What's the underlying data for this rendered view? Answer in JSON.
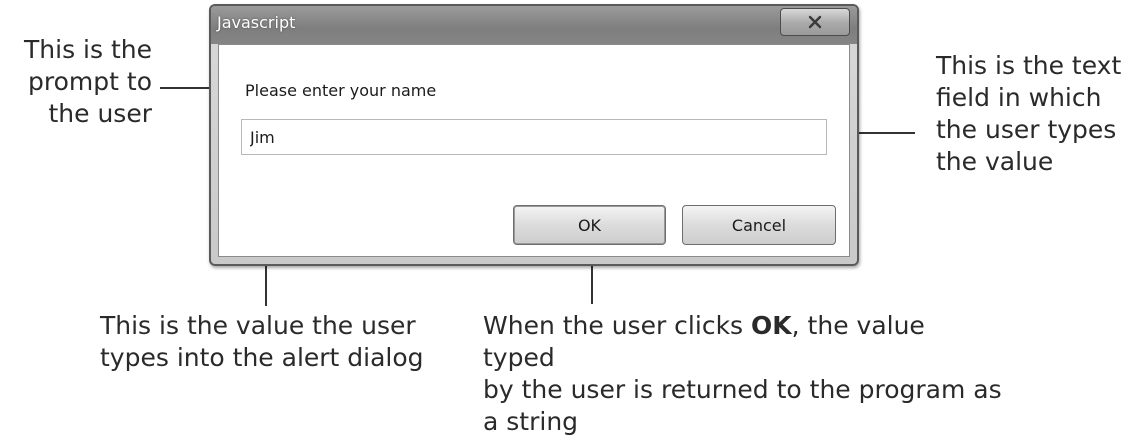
{
  "dialog": {
    "title": "Javascript",
    "close_label": "X",
    "prompt": "Please enter your name",
    "input_value": "Jim",
    "ok_label": "OK",
    "cancel_label": "Cancel"
  },
  "annotations": {
    "prompt": "This is the\nprompt to\nthe user",
    "text_field": "This is the text\nfield in which\nthe user types\nthe value",
    "value": "This is the value the user\ntypes into the alert dialog",
    "ok_before": "When the user clicks ",
    "ok_bold": "OK",
    "ok_after": ", the value typed\nby the user is returned to the program as\na string"
  },
  "colors": {
    "titlebar": "#858585",
    "frame": "#c9c9c9",
    "annotation_text": "#2a2a2a"
  }
}
